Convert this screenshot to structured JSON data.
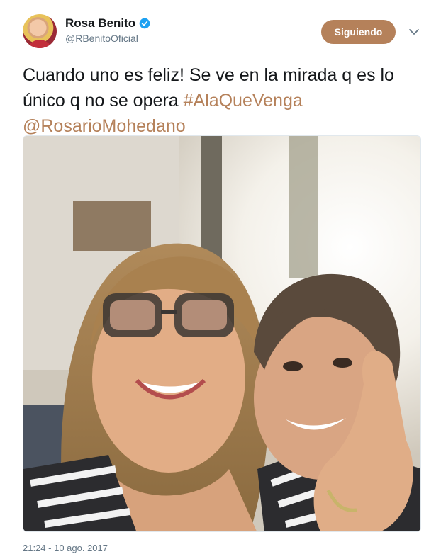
{
  "user": {
    "name": "Rosa Benito",
    "handle": "@RBenitoOficial",
    "verified": true
  },
  "follow_button": {
    "label": "Siguiendo"
  },
  "tweet": {
    "text_plain": "Cuando uno es feliz! Se ve en la mirada q es lo único q no se opera ",
    "hashtag": "#AlaQueVenga",
    "mention": "@RosarioMohedano",
    "timestamp": "21:24 - 10 ago. 2017"
  },
  "colors": {
    "accent": "#b5815a",
    "verified": "#1da1f2",
    "text": "#14171a",
    "muted": "#657786"
  },
  "icons": {
    "verified": "verified-badge-icon",
    "more": "chevron-down-icon"
  }
}
